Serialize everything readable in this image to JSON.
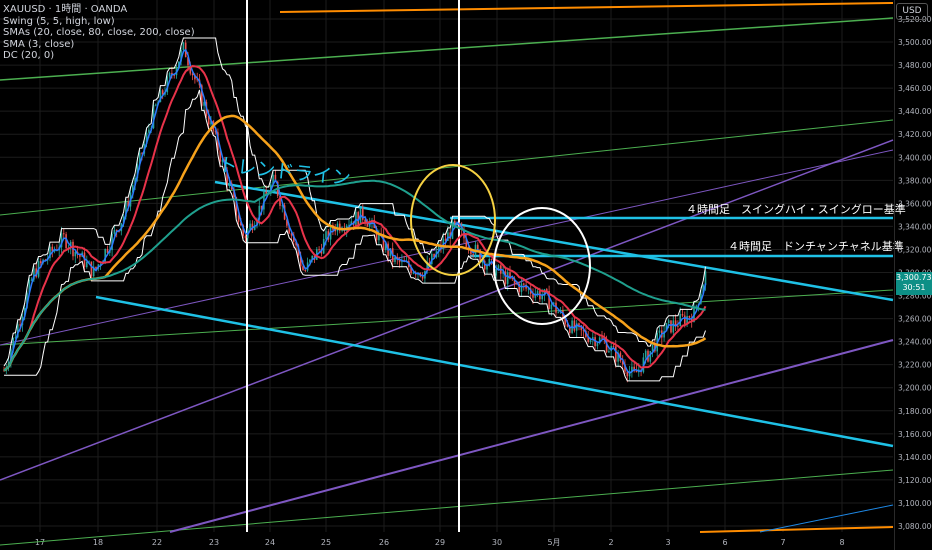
{
  "legend": {
    "symbol": "XAUUSD · 1時間 · OANDA",
    "ind1": "Swing (5, 5, high, low)",
    "ind2": "SMAs (20, close, 80, close, 200, close)",
    "ind3": "SMA (3, close)",
    "ind4": "DC (20, 0)"
  },
  "annotations": {
    "trendline": "トレンドライン",
    "swing_note": "４時間足　スイングハイ・スイングロー基準",
    "donchian_note": "４時間足　ドンチャンチャネル基準"
  },
  "price_axis": {
    "currency": "USD",
    "current_price": "3,300.735",
    "countdown": "30:51",
    "labels": [
      "3,520.000",
      "3,500.000",
      "3,480.000",
      "3,460.000",
      "3,440.000",
      "3,420.000",
      "3,400.000",
      "3,380.000",
      "3,360.000",
      "3,340.000",
      "3,320.000",
      "3,300.000",
      "3,280.000",
      "3,260.000",
      "3,240.000",
      "3,220.000",
      "3,200.000",
      "3,180.000",
      "3,160.000",
      "3,140.000",
      "3,120.000",
      "3,100.000",
      "3,080.000"
    ]
  },
  "time_axis": {
    "labels": [
      "17",
      "18",
      "22",
      "23",
      "24",
      "25",
      "26",
      "29",
      "30",
      "5月",
      "2",
      "3",
      "6",
      "7",
      "8"
    ]
  },
  "colors": {
    "background": "#000000",
    "grid": "#1c1c1c",
    "cyan_trend": "#1fc1e6",
    "sma20": "#e8334a",
    "sma80": "#f7a21b",
    "sma200": "#1fa08e",
    "sma3": "#2b7bff",
    "donchian": "#ffffff",
    "green_line": "#4caf50",
    "purple_line": "#7e57c2",
    "orange_line": "#ff8c00",
    "yellow_circle": "#f5d142",
    "white_circle": "#ffffff"
  },
  "chart_data": {
    "type": "line",
    "symbol": "XAUUSD",
    "timeframe": "1時間",
    "ylim": [
      3075,
      3530
    ],
    "x_ticks": [
      "17",
      "18",
      "22",
      "23",
      "24",
      "25",
      "26",
      "29",
      "30",
      "5月",
      "2",
      "3",
      "6",
      "7",
      "8"
    ],
    "y_ticks": [
      3080,
      3100,
      3120,
      3140,
      3160,
      3180,
      3200,
      3220,
      3240,
      3260,
      3280,
      3300,
      3320,
      3340,
      3360,
      3380,
      3400,
      3420,
      3440,
      3460,
      3480,
      3500,
      3520
    ],
    "last_price": 3300.735,
    "series": [
      {
        "x": [
          0,
          0.5,
          1,
          1.5,
          2,
          2.5,
          3,
          3.5,
          4,
          4.5,
          5,
          5.5,
          6,
          6.5,
          7,
          7.5,
          8,
          8.5,
          9,
          9.5,
          10,
          10.5,
          11,
          11.5,
          11.7
        ],
        "values": [
          3215,
          3300,
          3330,
          3300,
          3350,
          3440,
          3495,
          3420,
          3330,
          3380,
          3300,
          3340,
          3350,
          3310,
          3300,
          3340,
          3310,
          3290,
          3280,
          3250,
          3240,
          3210,
          3250,
          3265,
          3300
        ]
      }
    ]
  }
}
